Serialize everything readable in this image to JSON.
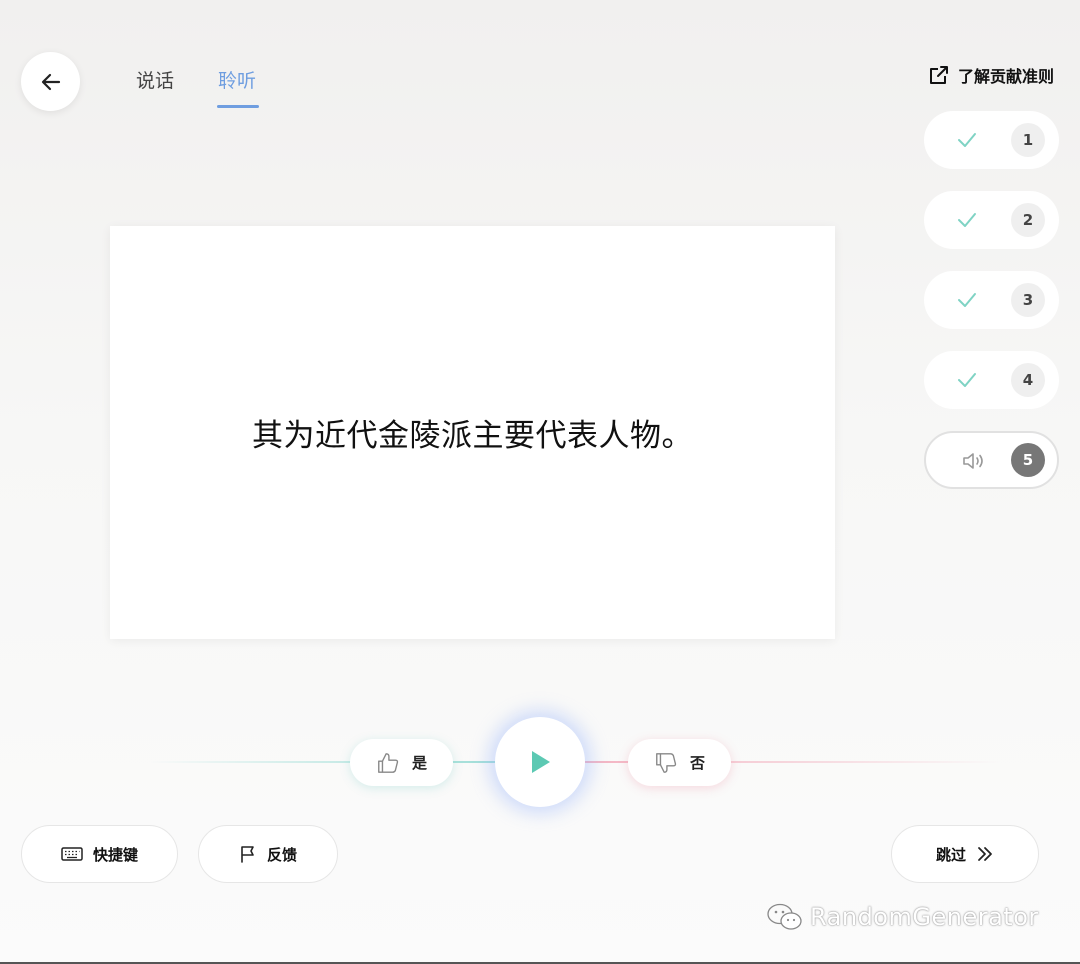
{
  "header": {
    "tabs": [
      {
        "label": "说话",
        "active": false
      },
      {
        "label": "聆听",
        "active": true
      }
    ],
    "guidelines_label": "了解贡献准则"
  },
  "progress": [
    {
      "number": "1",
      "status": "done"
    },
    {
      "number": "2",
      "status": "done"
    },
    {
      "number": "3",
      "status": "done"
    },
    {
      "number": "4",
      "status": "done"
    },
    {
      "number": "5",
      "status": "current"
    }
  ],
  "card": {
    "sentence": "其为近代金陵派主要代表人物。"
  },
  "controls": {
    "yes_label": "是",
    "no_label": "否"
  },
  "footer": {
    "shortcuts_label": "快捷键",
    "feedback_label": "反馈",
    "skip_label": "跳过"
  },
  "watermark": {
    "text": "RandomGenerator"
  },
  "colors": {
    "accent_tab": "#6f9ee0",
    "check": "#7fd3c4",
    "play": "#5cc9b3",
    "current_badge": "#777777"
  }
}
